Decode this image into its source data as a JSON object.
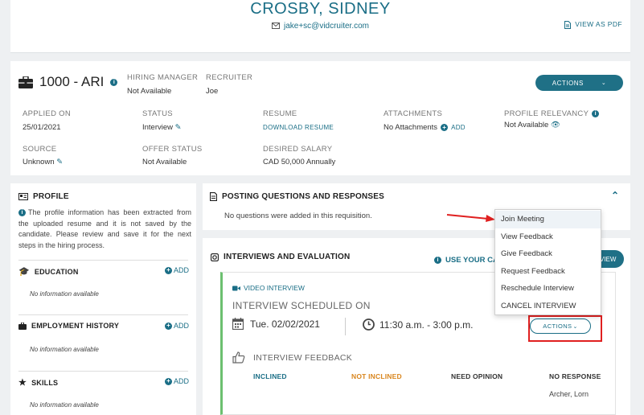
{
  "candidate": {
    "name": "CROSBY, SIDNEY",
    "email": "jake+sc@vidcruiter.com",
    "view_pdf": "VIEW AS PDF"
  },
  "job": {
    "title": "1000 - ARI",
    "hiring_manager_label": "HIRING MANAGER",
    "hiring_manager_value": "Not Available",
    "recruiter_label": "RECRUITER",
    "recruiter_value": "Joe",
    "actions_label": "ACTIONS",
    "applied_label": "APPLIED ON",
    "applied_value": "25/01/2021",
    "status_label": "STATUS",
    "status_value": "Interview",
    "resume_label": "RESUME",
    "resume_link": "DOWNLOAD RESUME",
    "attachments_label": "ATTACHMENTS",
    "attachments_value": "No Attachments",
    "attachments_add": "ADD",
    "relevancy_label": "PROFILE RELEVANCY",
    "relevancy_value": "Not Available",
    "source_label": "SOURCE",
    "source_value": "Unknown",
    "offer_label": "OFFER STATUS",
    "offer_value": "Not Available",
    "salary_label": "DESIRED SALARY",
    "salary_value": "CAD 50,000 Annually"
  },
  "profile": {
    "title": "PROFILE",
    "text": "The profile information has been extracted from the uploaded resume and it is not saved by the candidate. Please review and save it for the next steps in the hiring process.",
    "add_label": "ADD",
    "no_info": "No information available",
    "sections": {
      "education": "EDUCATION",
      "employment": "EMPLOYMENT HISTORY",
      "skills": "SKILLS"
    }
  },
  "posting": {
    "title": "POSTING QUESTIONS AND RESPONSES",
    "empty": "No questions were added in this requisition."
  },
  "interviews": {
    "title": "INTERVIEWS AND EVALUATION",
    "use_calendar": "USE YOUR CA",
    "partial_button": "VIEW",
    "video_label": "VIDEO INTERVIEW",
    "scheduled": "INTERVIEW SCHEDULED ON",
    "date": "Tue. 02/02/2021",
    "time": "11:30 a.m. - 3:00 p.m.",
    "actions_label": "ACTIONS",
    "feedback_title": "INTERVIEW FEEDBACK",
    "columns": {
      "inclined": "INCLINED",
      "not_inclined": "NOT INCLINED",
      "need_opinion": "NEED OPINION",
      "no_response": "NO RESPONSE"
    },
    "reviewer": "Archer, Lorn"
  },
  "dropdown": {
    "items": [
      "Join Meeting",
      "View Feedback",
      "Give Feedback",
      "Request Feedback",
      "Reschedule Interview",
      "CANCEL INTERVIEW"
    ]
  },
  "colors": {
    "accent": "#1a6e86",
    "inclined": "#1a6e86",
    "not_inclined": "#d9861e",
    "highlight": "#e02020",
    "success_border": "#6cc070"
  }
}
